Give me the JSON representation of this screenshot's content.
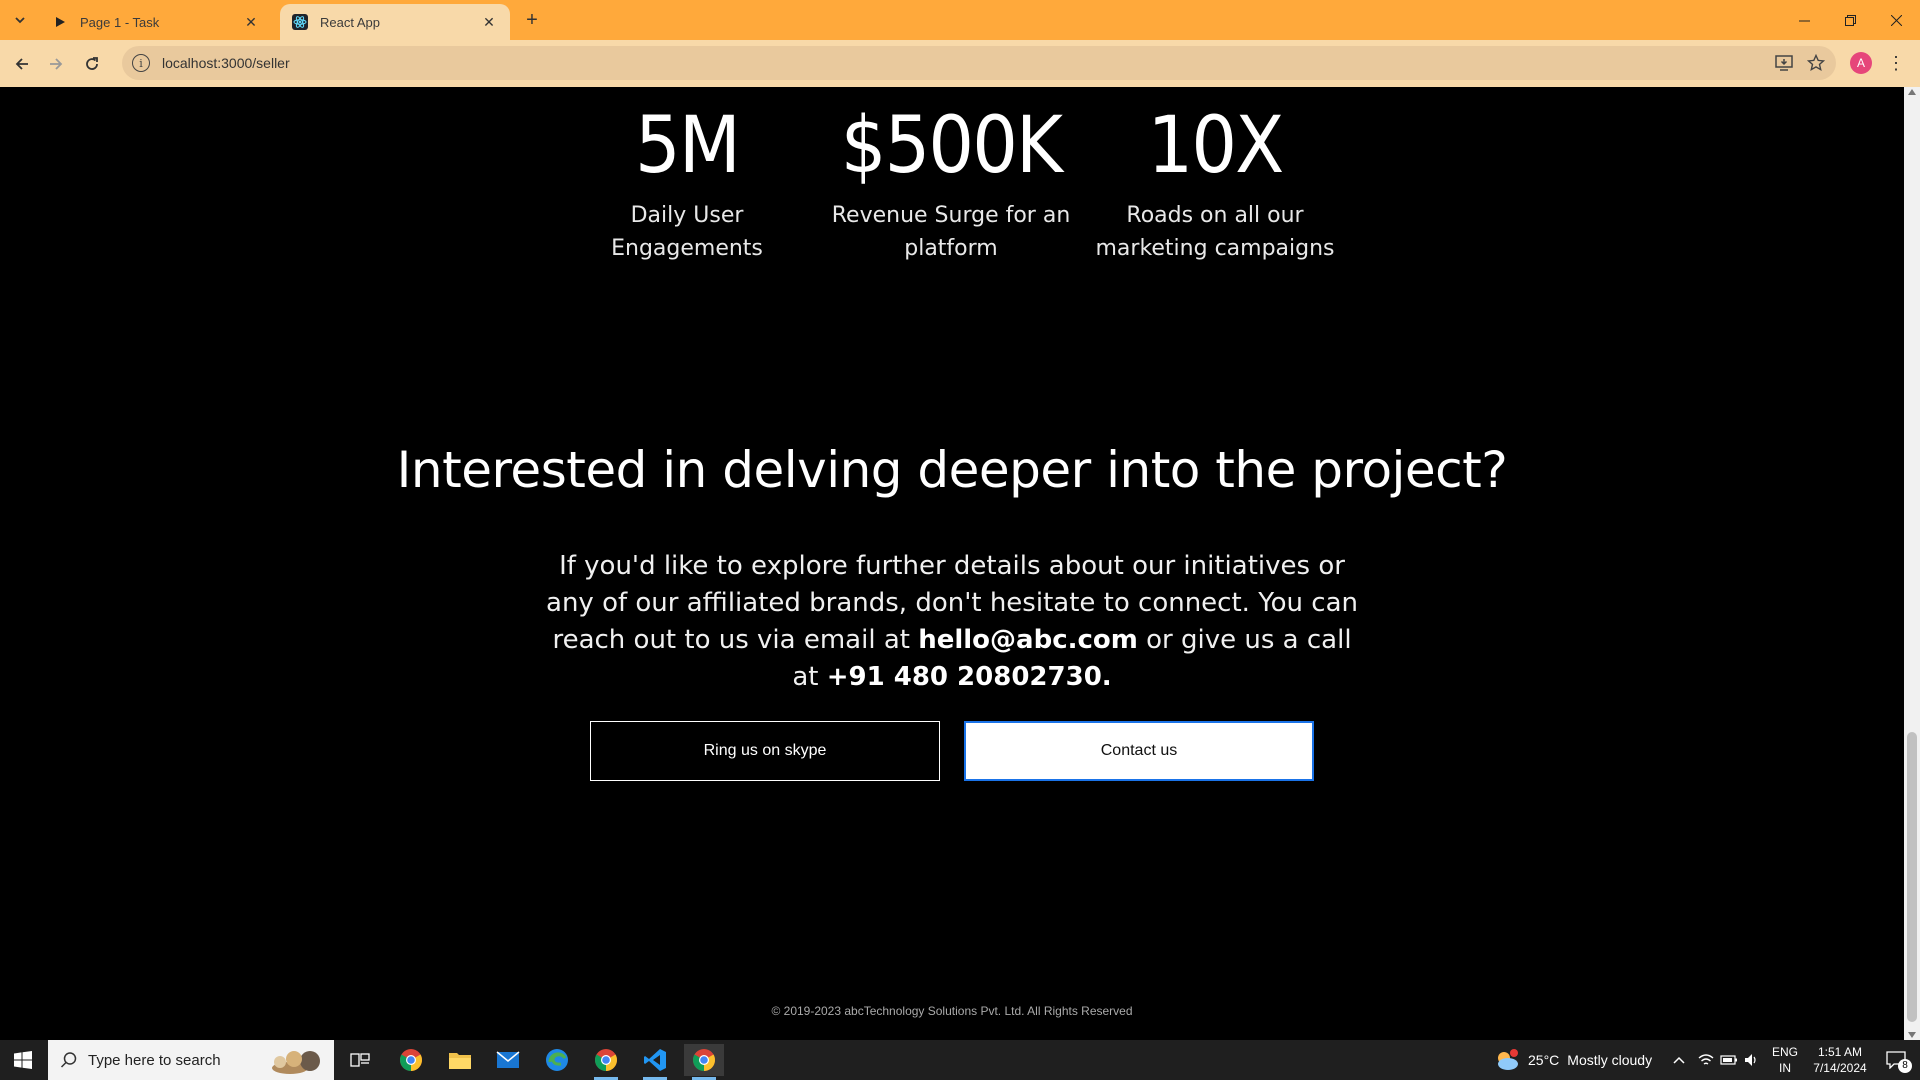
{
  "browser": {
    "tabs": [
      {
        "title": "Page 1 - Task",
        "active": false,
        "favicon": "play-icon"
      },
      {
        "title": "React App",
        "active": true,
        "favicon": "react-icon"
      }
    ],
    "url": "localhost:3000/seller",
    "profile_initial": "A",
    "accent_color": "#ffa93b"
  },
  "page": {
    "stats": [
      {
        "value": "5M",
        "label": "Daily User Engagements"
      },
      {
        "value": "$500K",
        "label": "Revenue Surge for an platform"
      },
      {
        "value": "10X",
        "label": "Roads on all our marketing campaigns"
      }
    ],
    "headline": "Interested in delving deeper into the project?",
    "paragraph": {
      "part1": "If you'd like to explore further details about our initiatives or any of our affiliated brands, don't hesitate to connect. You can reach out to us via email at ",
      "email": "hello@abc.com",
      "part2": " or give us a call at ",
      "phone": "+91 480 20802730."
    },
    "buttons": {
      "skype": "Ring us on skype",
      "contact": "Contact us"
    },
    "footer": "© 2019-2023 abcTechnology Solutions Pvt. Ltd. All Rights Reserved"
  },
  "taskbar": {
    "search_placeholder": "Type here to search",
    "weather": {
      "temp": "25°C",
      "condition": "Mostly cloudy",
      "alert_count": "1"
    },
    "language": {
      "line1": "ENG",
      "line2": "IN"
    },
    "clock": {
      "time": "1:51 AM",
      "date": "7/14/2024"
    },
    "notification_count": "8"
  }
}
